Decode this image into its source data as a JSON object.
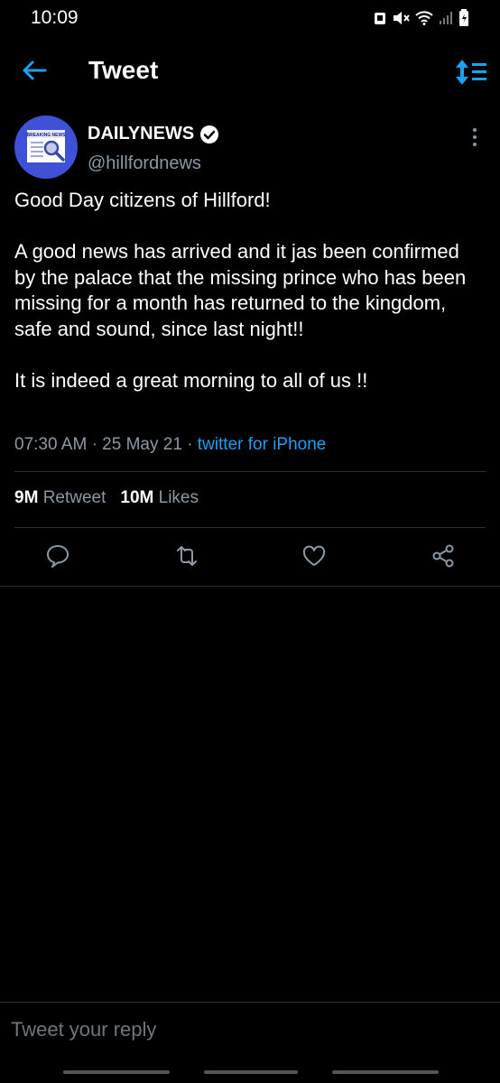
{
  "status": {
    "time": "10:09"
  },
  "header": {
    "title": "Tweet"
  },
  "tweet": {
    "name": "DAILYNEWS",
    "handle": "@hillfordnews",
    "avatar_text": "BREAKING NEWS",
    "body": "Good Day citizens of Hillford!\n\nA good news has arrived and it jas been confirmed by the palace that the missing prince who has been missing for a month has returned to the kingdom, safe and sound, since last night!!\n\nIt is indeed a great morning to all of us !!",
    "time": "07:30 AM",
    "date": "25 May 21",
    "source": "twitter for iPhone",
    "retweets_count": "9M",
    "retweets_label": "Retweet",
    "likes_count": "10M",
    "likes_label": "Likes"
  },
  "reply": {
    "placeholder": "Tweet your reply"
  },
  "colors": {
    "accent": "#1da1f2",
    "background": "#000000",
    "muted": "#8b98a5"
  },
  "icons": [
    "back-arrow-icon",
    "sort-icon",
    "verified-icon",
    "more-icon",
    "reply-icon",
    "retweet-icon",
    "like-icon",
    "share-icon"
  ]
}
